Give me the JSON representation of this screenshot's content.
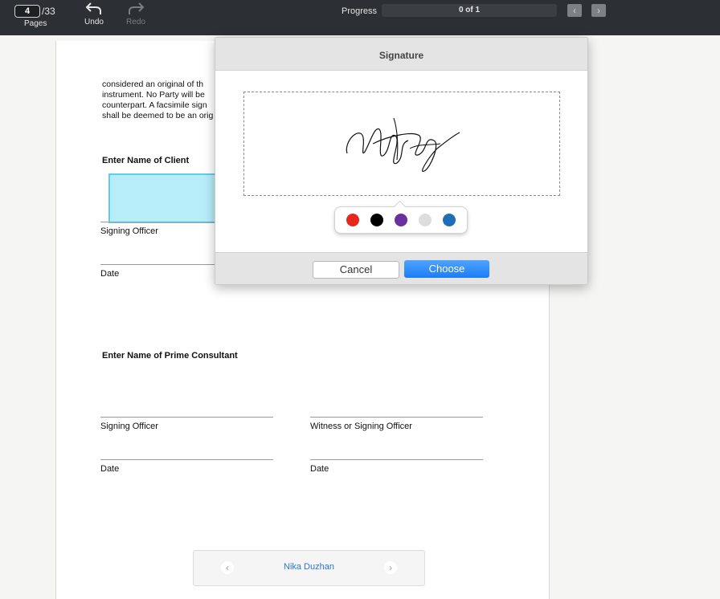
{
  "toolbar": {
    "current_page": "4",
    "total_pages": "/33",
    "pages_label": "Pages",
    "undo_label": "Undo",
    "redo_label": "Redo",
    "progress_label": "Progress",
    "progress_text": "0 of 1",
    "progress_fraction": 0,
    "prev_icon": "chevron-left-icon",
    "next_icon": "chevron-right-icon"
  },
  "document": {
    "paragraph": "considered an original of th\ninstrument.  No Party will be\ncounterpart. A facsimile sign\nshall be deemed to be an orig",
    "client_heading": "Enter Name of Client",
    "client_signing_officer": "Signing Officer",
    "client_date": "Date",
    "consultant_heading": "Enter Name of Prime Consultant",
    "consultant_signing_officer": "Signing Officer",
    "consultant_witness": "Witness or Signing Officer",
    "consultant_date_left": "Date",
    "consultant_date_right": "Date"
  },
  "signer_nav": {
    "name": "Nika Duzhan"
  },
  "dialog": {
    "title": "Signature",
    "colors": [
      "#e8261c",
      "#000000",
      "#6b2fa0",
      "#dddddd",
      "#1e6fb8"
    ],
    "cancel_label": "Cancel",
    "choose_label": "Choose"
  }
}
